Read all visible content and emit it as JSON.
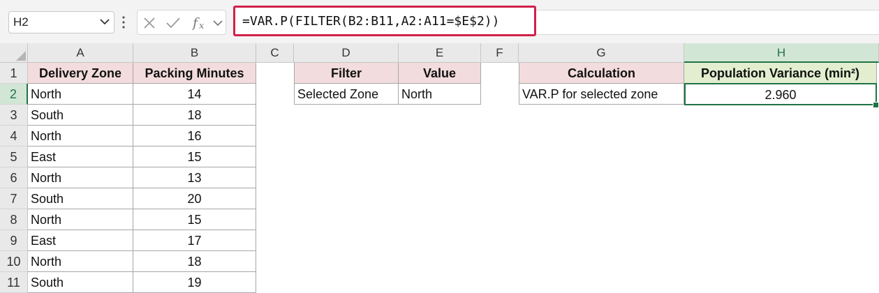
{
  "formula_bar": {
    "name_box": "H2",
    "formula": "=VAR.P(FILTER(B2:B11,A2:A11=$E$2))"
  },
  "columns": [
    "A",
    "B",
    "C",
    "D",
    "E",
    "F",
    "G",
    "H"
  ],
  "rows": [
    "1",
    "2",
    "3",
    "4",
    "5",
    "6",
    "7",
    "8",
    "9",
    "10",
    "11"
  ],
  "table_main": {
    "headers": [
      "Delivery Zone",
      "Packing Minutes"
    ],
    "rows": [
      [
        "North",
        "14"
      ],
      [
        "South",
        "18"
      ],
      [
        "North",
        "16"
      ],
      [
        "East",
        "15"
      ],
      [
        "North",
        "13"
      ],
      [
        "South",
        "20"
      ],
      [
        "North",
        "15"
      ],
      [
        "East",
        "17"
      ],
      [
        "North",
        "18"
      ],
      [
        "South",
        "19"
      ]
    ]
  },
  "table_filter": {
    "headers": [
      "Filter",
      "Value"
    ],
    "row": [
      "Selected Zone",
      "North"
    ]
  },
  "table_calc": {
    "headers": [
      "Calculation",
      "Population Variance (min²)"
    ],
    "row": [
      "VAR.P for selected zone",
      "2.960"
    ]
  },
  "colors": {
    "accent": "#217346",
    "formula_highlight": "#d0204a",
    "header_pink": "#f3dcdd",
    "header_green": "#e2eecf"
  }
}
